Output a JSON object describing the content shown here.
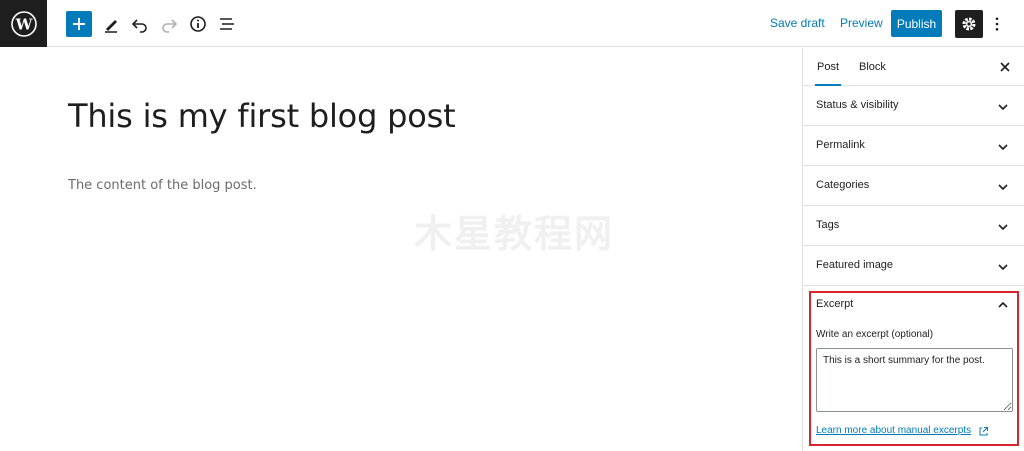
{
  "toolbar": {
    "save_draft": "Save draft",
    "preview": "Preview",
    "publish": "Publish"
  },
  "post": {
    "title": "This is my first blog post",
    "content": "The content of the blog post."
  },
  "watermark": "木星教程网",
  "sidebar": {
    "tabs": [
      "Post",
      "Block"
    ],
    "panels": [
      {
        "label": "Status & visibility"
      },
      {
        "label": "Permalink"
      },
      {
        "label": "Categories"
      },
      {
        "label": "Tags"
      },
      {
        "label": "Featured image"
      }
    ],
    "excerpt": {
      "title": "Excerpt",
      "field_label": "Write an excerpt (optional)",
      "value": "This is a short summary for the post.",
      "learn_more": "Learn more about manual excerpts"
    }
  },
  "colors": {
    "accent": "#007cba",
    "dark": "#1e1e1e",
    "highlight": "#d9232d"
  }
}
